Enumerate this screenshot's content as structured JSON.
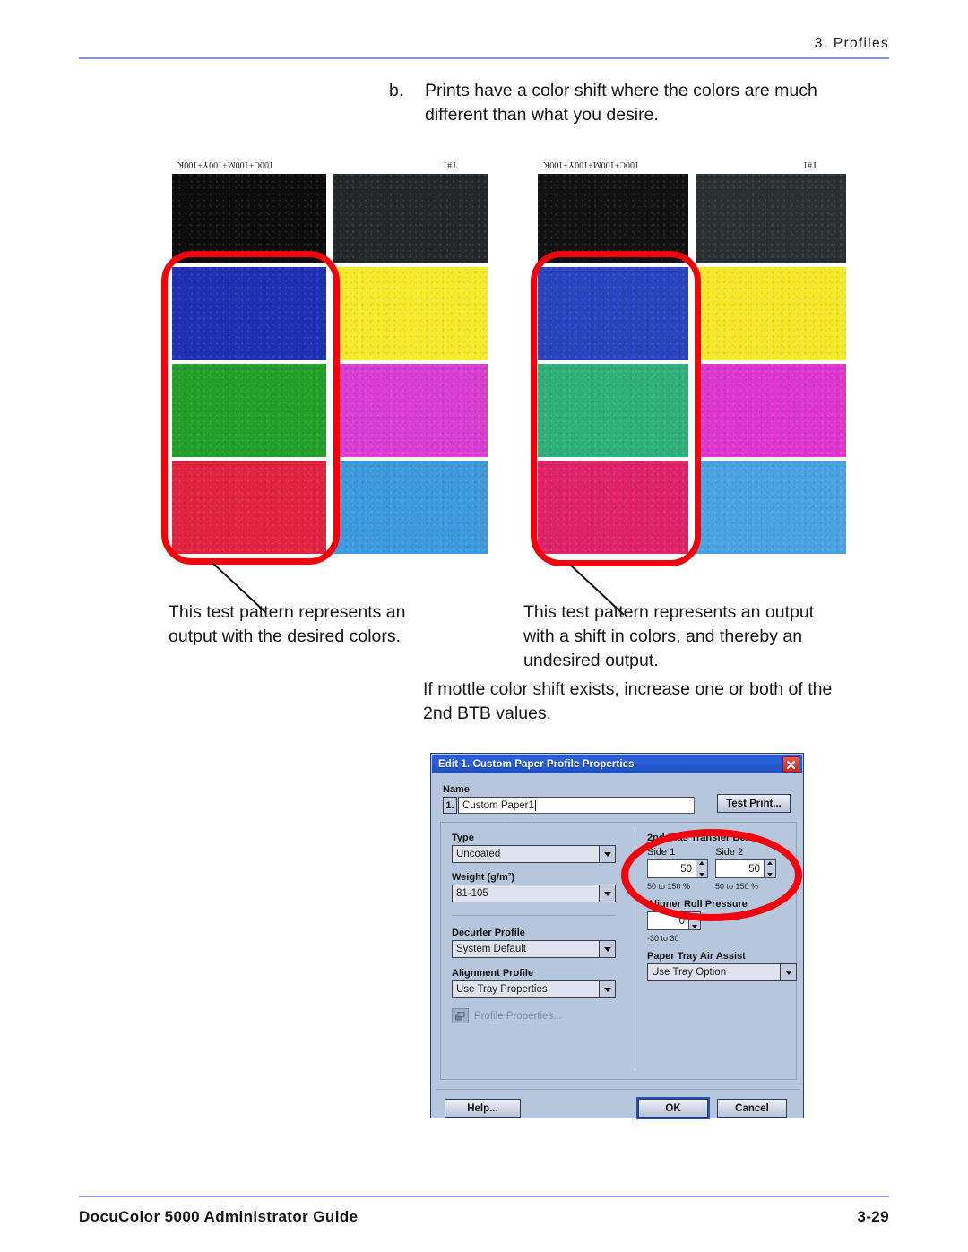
{
  "header": {
    "running_head": "3. Profiles"
  },
  "item_b": {
    "marker": "b.",
    "text": "Prints have a color shift where the colors are much different than what you desire."
  },
  "patterns": [
    {
      "id": "desired",
      "label_left": "100C+100M+100Y+100K",
      "label_right": "T#1",
      "swatches_left": [
        "#0d0d0d",
        "#1f30b4",
        "#22a02a",
        "#e0233f"
      ],
      "swatches_right": [
        "#24282a",
        "#f5ea2b",
        "#d93fd3",
        "#3f9ade"
      ],
      "caption": "This test pattern represents an output with the desired colors."
    },
    {
      "id": "shifted",
      "label_left": "100C+100M+100Y+100K",
      "label_right": "T#1",
      "swatches_left": [
        "#121212",
        "#2a45bd",
        "#2fb07a",
        "#e0246a"
      ],
      "swatches_right": [
        "#2b3133",
        "#f5e82b",
        "#dc36cf",
        "#4aa3e0"
      ],
      "caption": "This test pattern represents an output with a shift in colors, and thereby an undesired output."
    }
  ],
  "note": "If mottle color shift exists, increase one or both of the 2nd BTB values.",
  "dialog": {
    "title": "Edit 1. Custom Paper Profile Properties",
    "close_icon": "close-icon",
    "name_label": "Name",
    "name_index": "1.",
    "name_value": "Custom Paper1",
    "test_print_label": "Test Print...",
    "type_label": "Type",
    "type_value": "Uncoated",
    "weight_label": "Weight (g/m²)",
    "weight_value": "81-105",
    "decurler_label": "Decurler Profile",
    "decurler_value": "System Default",
    "alignment_label": "Alignment Profile",
    "alignment_value": "Use Tray Properties",
    "profile_properties_label": "Profile Properties...",
    "btb_group_label": "2nd Bias Transfer Belt",
    "btb_side1_label": "Side 1",
    "btb_side1_value": "50",
    "btb_side1_range": "50 to 150 %",
    "btb_side2_label": "Side 2",
    "btb_side2_value": "50",
    "btb_side2_range": "50 to 150 %",
    "aligner_label": "Aligner Roll Pressure",
    "aligner_value": "0",
    "aligner_range": "-30 to 30",
    "air_assist_label": "Paper Tray Air Assist",
    "air_assist_value": "Use Tray Option",
    "help_label": "Help...",
    "ok_label": "OK",
    "cancel_label": "Cancel"
  },
  "footer": {
    "left": "DocuColor 5000 Administrator Guide",
    "right": "3-29"
  },
  "colors": {
    "rule": "#8b8fe0",
    "annotation_red": "#f4000b",
    "titlebar_blue": "#2a5fd6",
    "dialog_bg": "#b6c6dd"
  }
}
